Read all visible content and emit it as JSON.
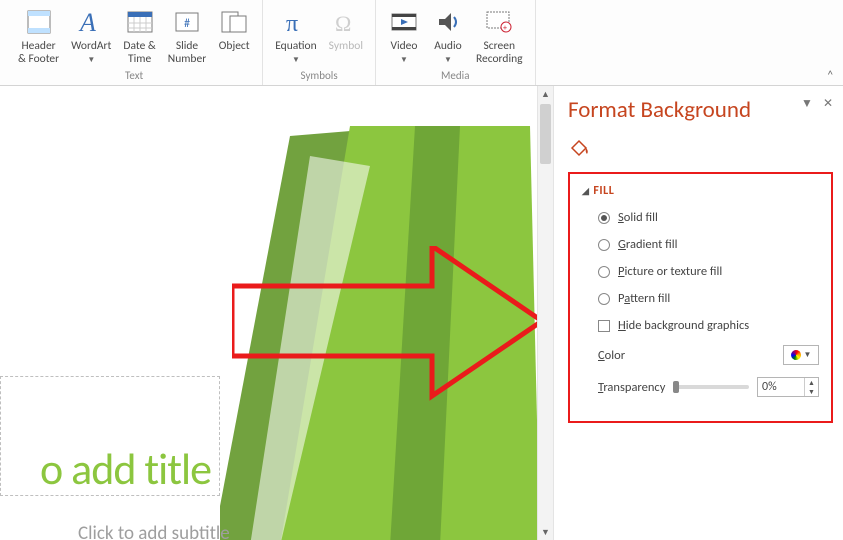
{
  "ribbon": {
    "groups": [
      {
        "name": "Text",
        "items": [
          {
            "id": "header-footer",
            "label_line1": "Header",
            "label_line2": "& Footer",
            "dropdown": false
          },
          {
            "id": "wordart",
            "label_line1": "WordArt",
            "label_line2": "",
            "dropdown": true
          },
          {
            "id": "date-time",
            "label_line1": "Date &",
            "label_line2": "Time",
            "dropdown": false
          },
          {
            "id": "slide-number",
            "label_line1": "Slide",
            "label_line2": "Number",
            "dropdown": false
          },
          {
            "id": "object",
            "label_line1": "Object",
            "label_line2": "",
            "dropdown": false
          }
        ]
      },
      {
        "name": "Symbols",
        "items": [
          {
            "id": "equation",
            "label_line1": "Equation",
            "label_line2": "",
            "dropdown": true,
            "disabled": false
          },
          {
            "id": "symbol",
            "label_line1": "Symbol",
            "label_line2": "",
            "dropdown": false,
            "disabled": true
          }
        ]
      },
      {
        "name": "Media",
        "items": [
          {
            "id": "video",
            "label_line1": "Video",
            "label_line2": "",
            "dropdown": true
          },
          {
            "id": "audio",
            "label_line1": "Audio",
            "label_line2": "",
            "dropdown": true
          },
          {
            "id": "screen-recording",
            "label_line1": "Screen",
            "label_line2": "Recording",
            "dropdown": false
          }
        ]
      }
    ],
    "collapse_glyph": "^"
  },
  "slide": {
    "title_placeholder": "o add title",
    "subtitle_placeholder": "Click to add subtitle"
  },
  "pane": {
    "title": "Format Background",
    "section": {
      "header": "FILL",
      "options": [
        {
          "id": "solid",
          "label": "Solid fill",
          "acc": "S",
          "selected": true
        },
        {
          "id": "gradient",
          "label": "Gradient fill",
          "acc": "G",
          "selected": false
        },
        {
          "id": "picture",
          "label": "Picture or texture fill",
          "acc": "P",
          "selected": false
        },
        {
          "id": "pattern",
          "label": "Pattern fill",
          "acc": "a",
          "selected": false
        }
      ],
      "hide_bg_label": "Hide background graphics",
      "hide_bg_acc": "H",
      "color_label": "Color",
      "color_acc": "C",
      "transparency_label": "Transparency",
      "transparency_acc": "T",
      "transparency_value": "0%"
    }
  }
}
